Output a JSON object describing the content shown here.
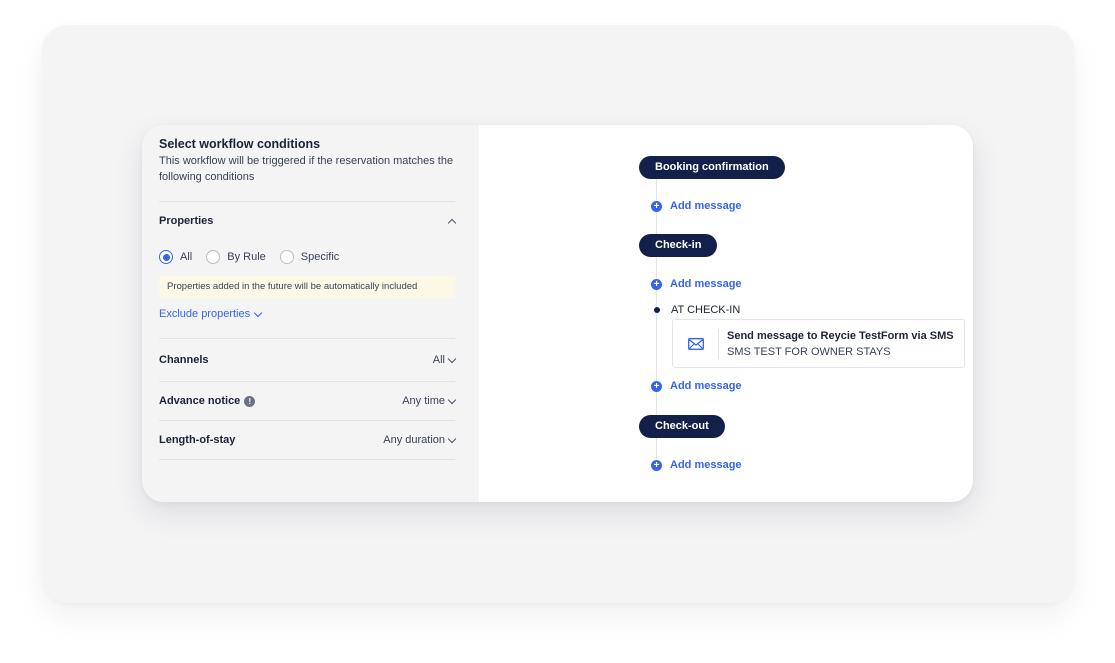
{
  "conditions": {
    "title": "Select workflow conditions",
    "description": "This workflow will be triggered if the reservation matches the following conditions"
  },
  "properties": {
    "label": "Properties",
    "options": [
      "All",
      "By Rule",
      "Specific"
    ],
    "selected": "All",
    "notice": "Properties added in the future will be automatically included",
    "exclude_link": "Exclude properties"
  },
  "channels": {
    "label": "Channels",
    "value": "All"
  },
  "advance_notice": {
    "label": "Advance notice",
    "value": "Any time",
    "info_icon": "!"
  },
  "length_of_stay": {
    "label": "Length-of-stay",
    "value": "Any duration"
  },
  "timeline": {
    "booking": "Booking confirmation",
    "checkin": "Check-in",
    "checkout": "Check-out",
    "add_message": "Add message",
    "trigger_label": "AT CHECK-IN",
    "message": {
      "title": "Send message to Reycie TestForm via SMS",
      "subtitle": "SMS TEST FOR OWNER STAYS",
      "icon": "envelope-icon"
    }
  },
  "colors": {
    "accent": "#3563e9",
    "pill": "#13214a",
    "notice_bg": "#fbf8e6",
    "panel_bg": "#f4f4f5"
  }
}
